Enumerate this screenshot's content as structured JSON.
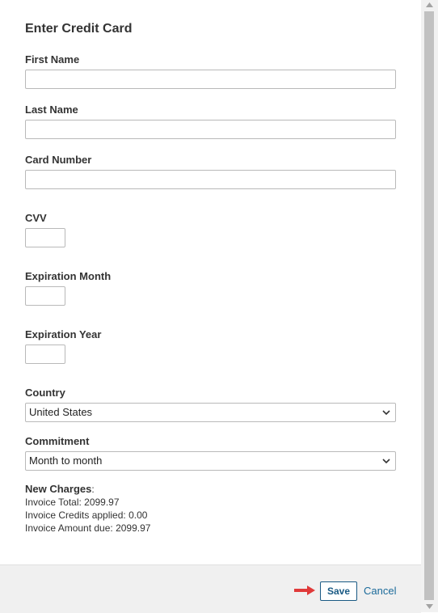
{
  "form": {
    "title": "Enter Credit Card",
    "first_name_label": "First Name",
    "first_name_value": "",
    "last_name_label": "Last Name",
    "last_name_value": "",
    "card_number_label": "Card Number",
    "card_number_value": "",
    "cvv_label": "CVV",
    "cvv_value": "",
    "exp_month_label": "Expiration Month",
    "exp_month_value": "",
    "exp_year_label": "Expiration Year",
    "exp_year_value": "",
    "country_label": "Country",
    "country_value": "United States",
    "commitment_label": "Commitment",
    "commitment_value": "Month to month"
  },
  "charges": {
    "heading": "New Charges",
    "heading_suffix": ":",
    "invoice_total": "Invoice Total: 2099.97",
    "invoice_credits": "Invoice Credits applied: 0.00",
    "invoice_due": "Invoice Amount due: 2099.97"
  },
  "footer": {
    "save_label": "Save",
    "cancel_label": "Cancel"
  },
  "icons": {
    "arrow": "red-arrow-icon",
    "chevron": "chevron-down-icon"
  },
  "colors": {
    "accent": "#1a5a84",
    "arrow": "#e03a3a"
  }
}
